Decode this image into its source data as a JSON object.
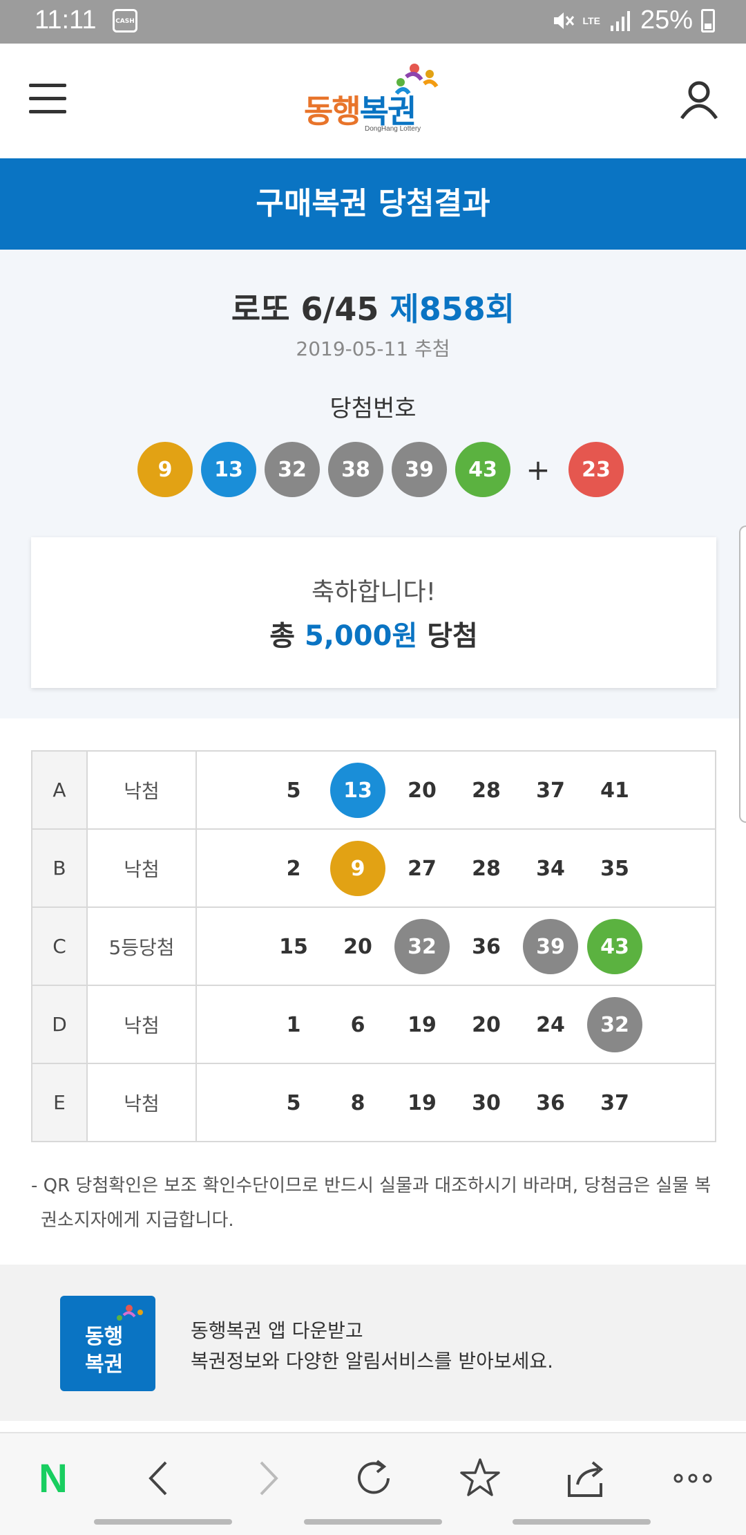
{
  "status_bar": {
    "time": "11:11",
    "cash_label": "CASH",
    "network": "LTE",
    "battery": "25%"
  },
  "header": {
    "logo_text": "동행복권",
    "logo_sub": "DongHang Lottery"
  },
  "title_bar": {
    "title": "구매복권 당첨결과"
  },
  "draw": {
    "game": "로또 6/45",
    "round": "제858회",
    "date": "2019-05-11 추첨",
    "winning_label": "당첨번호",
    "numbers": [
      "9",
      "13",
      "32",
      "38",
      "39",
      "43"
    ],
    "plus": "+",
    "bonus": "23"
  },
  "result": {
    "congrats": "축하합니다!",
    "total_prefix": "총",
    "total_amount": "5,000원",
    "total_suffix": "당첨"
  },
  "tickets": [
    {
      "key": "A",
      "result": "낙첨",
      "numbers": [
        "5",
        "13",
        "20",
        "28",
        "37",
        "41"
      ]
    },
    {
      "key": "B",
      "result": "낙첨",
      "numbers": [
        "2",
        "9",
        "27",
        "28",
        "34",
        "35"
      ]
    },
    {
      "key": "C",
      "result": "5등당첨",
      "numbers": [
        "15",
        "20",
        "32",
        "36",
        "39",
        "43"
      ]
    },
    {
      "key": "D",
      "result": "낙첨",
      "numbers": [
        "1",
        "6",
        "19",
        "20",
        "24",
        "32"
      ]
    },
    {
      "key": "E",
      "result": "낙첨",
      "numbers": [
        "5",
        "8",
        "19",
        "30",
        "36",
        "37"
      ]
    }
  ],
  "notice": {
    "line1": "- QR 당첨확인은 보조 확인수단이므로 반드시 실물과 대조하시기 바라며, 당첨금은 실물 복",
    "line2": "권소지자에게 지급합니다."
  },
  "promo": {
    "logo_line1": "동행",
    "logo_line2": "복권",
    "line1": "동행복권 앱 다운받고",
    "line2": "복권정보와 다양한 알림서비스를 받아보세요."
  },
  "browser_bar": {
    "home_icon": "N",
    "items": [
      "naver-home",
      "back",
      "forward",
      "reload",
      "bookmark",
      "share",
      "more"
    ]
  },
  "colors": {
    "brand_blue": "#0a74c3",
    "ball_yellow": "#e2a214",
    "ball_blue": "#1a8ed8",
    "ball_gray": "#888888",
    "ball_green": "#5bb240",
    "ball_red": "#e5574f"
  }
}
